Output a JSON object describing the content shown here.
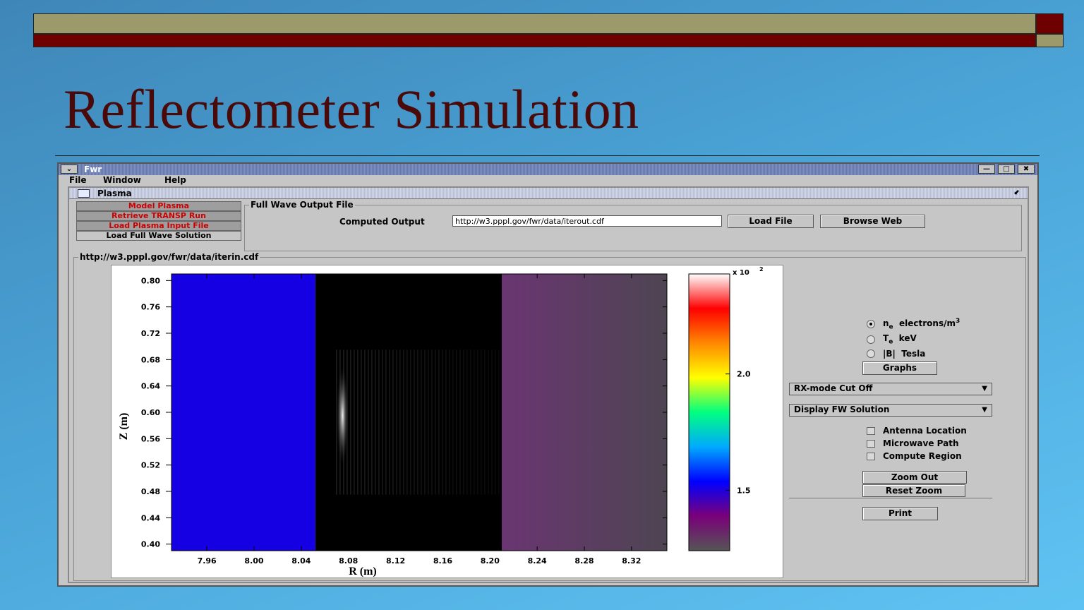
{
  "slide": {
    "title": "Reflectometer Simulation"
  },
  "window": {
    "title": "Fwr",
    "menu_glyph": "⌄",
    "controls": {
      "minimize": "—",
      "maximize": "□",
      "close": "✖"
    }
  },
  "menubar": {
    "file": "File",
    "window": "Window",
    "help": "Help"
  },
  "panel": {
    "title": "Plasma",
    "maximize_glyph": "⬋",
    "tabs": [
      "Model Plasma",
      "Retrieve TRANSP Run",
      "Load Plasma Input File",
      "Load Full Wave Solution"
    ],
    "active_tab": 3
  },
  "output_group": {
    "legend": "Full Wave Output File",
    "field_label": "Computed Output",
    "field_value": "http://w3.pppl.gov/fwr/data/iterout.cdf",
    "load_button": "Load File",
    "browse_button": "Browse Web"
  },
  "plot_group": {
    "legend": "http://w3.pppl.gov/fwr/data/iterin.cdf"
  },
  "controls": {
    "radios": [
      {
        "label": "n",
        "sub": "e",
        "suffix": "electrons/m",
        "sup": "3",
        "selected": true
      },
      {
        "label": "T",
        "sub": "e",
        "suffix": "keV",
        "sup": "",
        "selected": false
      },
      {
        "label": "|B|",
        "sub": "",
        "suffix": "Tesla",
        "sup": "",
        "selected": false
      }
    ],
    "graphs_button": "Graphs",
    "mode_select": "RX-mode Cut Off",
    "display_select": "Display FW Solution",
    "checkboxes": [
      "Antenna Location",
      "Microwave Path",
      "Compute Region"
    ],
    "zoom_out": "Zoom Out",
    "reset_zoom": "Reset Zoom",
    "print": "Print"
  },
  "chart_data": {
    "type": "heatmap",
    "xlabel": "R (m)",
    "ylabel": "Z (m)",
    "xlim": [
      7.93,
      8.35
    ],
    "ylim": [
      0.39,
      0.81
    ],
    "x_ticks": [
      "7.96",
      "8.00",
      "8.04",
      "8.08",
      "8.12",
      "8.16",
      "8.20",
      "8.24",
      "8.28",
      "8.32"
    ],
    "y_ticks": [
      "0.80",
      "0.76",
      "0.72",
      "0.68",
      "0.64",
      "0.60",
      "0.56",
      "0.52",
      "0.48",
      "0.44",
      "0.40"
    ],
    "regions": [
      {
        "name": "vacuum",
        "r_start": 7.93,
        "r_end": 8.052,
        "color": "#1500e3"
      },
      {
        "name": "fw-solution",
        "r_start": 8.052,
        "r_end": 8.21,
        "color": "#000000"
      },
      {
        "name": "plasma",
        "r_start": 8.21,
        "r_end": 8.35,
        "color": "#5f3a63"
      }
    ],
    "wave_peak": {
      "r": 8.075,
      "z": 0.595
    },
    "colorbar": {
      "multiplier": "x 10",
      "multiplier_exp": "2",
      "ticks": [
        "2.0",
        "1.5"
      ],
      "tick_values": [
        200,
        150
      ],
      "range": [
        124,
        243
      ],
      "colors": [
        "#555555",
        "#7a007a",
        "#0000ff",
        "#00aaff",
        "#00ff80",
        "#ffff00",
        "#ff8800",
        "#ff0000",
        "#ffffff"
      ]
    }
  }
}
